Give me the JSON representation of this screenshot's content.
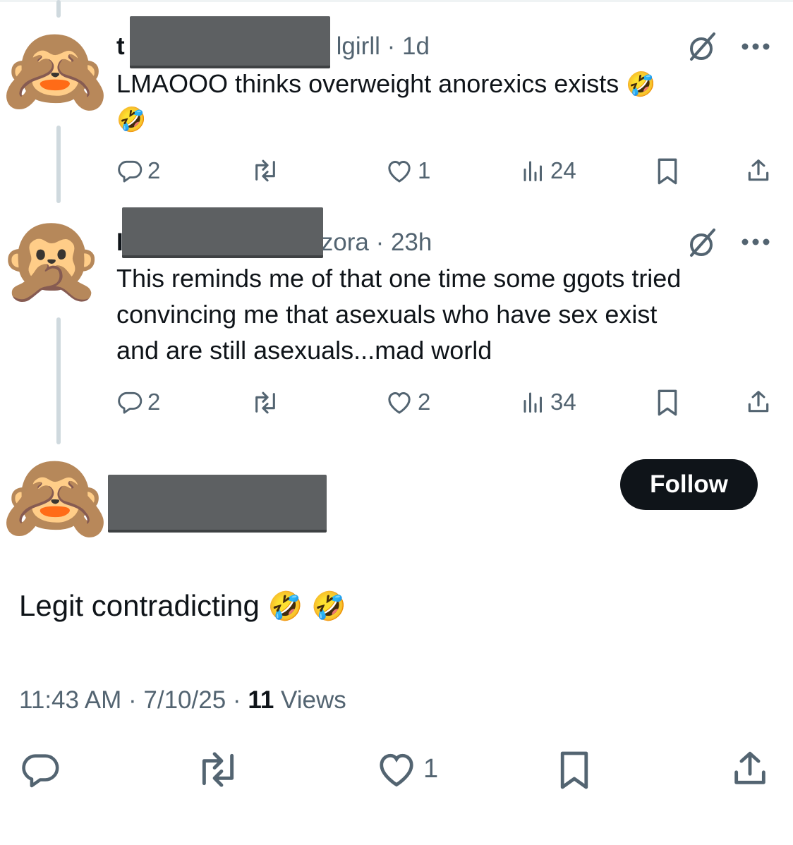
{
  "replies": [
    {
      "handle_prefix": "t",
      "handle_suffix": "lgirll",
      "time": "1d",
      "text": "LMAOOO thinks overweight anorexics exists",
      "emoji": "🤣",
      "avatar_emoji": "🙈",
      "replies": "2",
      "reposts": "",
      "likes": "1",
      "views": "24"
    },
    {
      "handle_prefix": "I",
      "handle_suffix": "zora",
      "time": "23h",
      "text_lines": [
        "This reminds me of that one time some ggots tried",
        "convincing me that asexuals who have sex exist",
        "and are still asexuals...mad world"
      ],
      "avatar_emoji": "🙊",
      "replies": "2",
      "reposts": "",
      "likes": "2",
      "views": "34"
    }
  ],
  "main_post": {
    "avatar_emoji": "🙈",
    "follow_label": "Follow",
    "text": "Legit contradicting",
    "emoji_1": "🤣",
    "emoji_2": "🤣",
    "time": "11:43 AM",
    "date": "7/10/25",
    "views_count": "11",
    "views_label": "Views",
    "likes": "1"
  },
  "colors": {
    "text_primary": "#0f1419",
    "text_secondary": "#536471",
    "thread_line": "#cfd9de",
    "follow_button_bg": "#0f1419",
    "redaction": "#5d6062"
  }
}
